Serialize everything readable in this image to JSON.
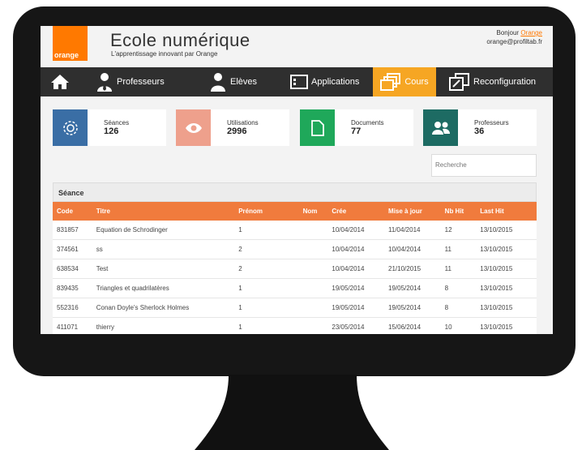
{
  "header": {
    "logo_text": "orange",
    "title": "Ecole numérique",
    "subtitle": "L'apprentissage innovant par Orange",
    "greeting_prefix": "Bonjour",
    "user_name": "Orange",
    "user_email": "orange@profiltab.fr"
  },
  "nav": {
    "items": [
      {
        "label": "",
        "icon": "home-icon"
      },
      {
        "label": "Professeurs",
        "icon": "teacher-icon"
      },
      {
        "label": "Elèves",
        "icon": "student-icon"
      },
      {
        "label": "Applications",
        "icon": "applications-icon"
      },
      {
        "label": "Cours",
        "icon": "courses-icon",
        "active": true
      },
      {
        "label": "Reconfiguration",
        "icon": "reconfiguration-icon"
      }
    ]
  },
  "stats": [
    {
      "label": "Séances",
      "value": "126",
      "icon": "gear-icon",
      "color": "#3a6ea5"
    },
    {
      "label": "Utilisations",
      "value": "2996",
      "icon": "eye-icon",
      "color": "#eea08c"
    },
    {
      "label": "Documents",
      "value": "77",
      "icon": "document-icon",
      "color": "#1fa85a"
    },
    {
      "label": "Professeurs",
      "value": "36",
      "icon": "users-icon",
      "color": "#1d6b63"
    }
  ],
  "search": {
    "placeholder": "Recherche"
  },
  "table": {
    "title": "Séance",
    "columns": [
      "Code",
      "Titre",
      "Prénom",
      "Nom",
      "Crée",
      "Mise à jour",
      "Nb Hit",
      "Last Hit"
    ],
    "rows": [
      [
        "831857",
        "Equation de Schrodinger",
        "1",
        "",
        "10/04/2014",
        "11/04/2014",
        "12",
        "13/10/2015"
      ],
      [
        "374561",
        "ss",
        "2",
        "",
        "10/04/2014",
        "10/04/2014",
        "11",
        "13/10/2015"
      ],
      [
        "638534",
        "Test",
        "2",
        "",
        "10/04/2014",
        "21/10/2015",
        "11",
        "13/10/2015"
      ],
      [
        "839435",
        "Triangles et quadrilatères",
        "1",
        "",
        "19/05/2014",
        "19/05/2014",
        "8",
        "13/10/2015"
      ],
      [
        "552316",
        "Conan Doyle's Sherlock Holmes",
        "1",
        "",
        "19/05/2014",
        "19/05/2014",
        "8",
        "13/10/2015"
      ],
      [
        "411071",
        "thierry",
        "1",
        "",
        "23/05/2014",
        "15/06/2014",
        "10",
        "13/10/2015"
      ]
    ]
  },
  "colors": {
    "accent": "#ff7900",
    "nav_bg": "#2f2f2f",
    "nav_active": "#f6a623",
    "table_header": "#f07b3d"
  }
}
